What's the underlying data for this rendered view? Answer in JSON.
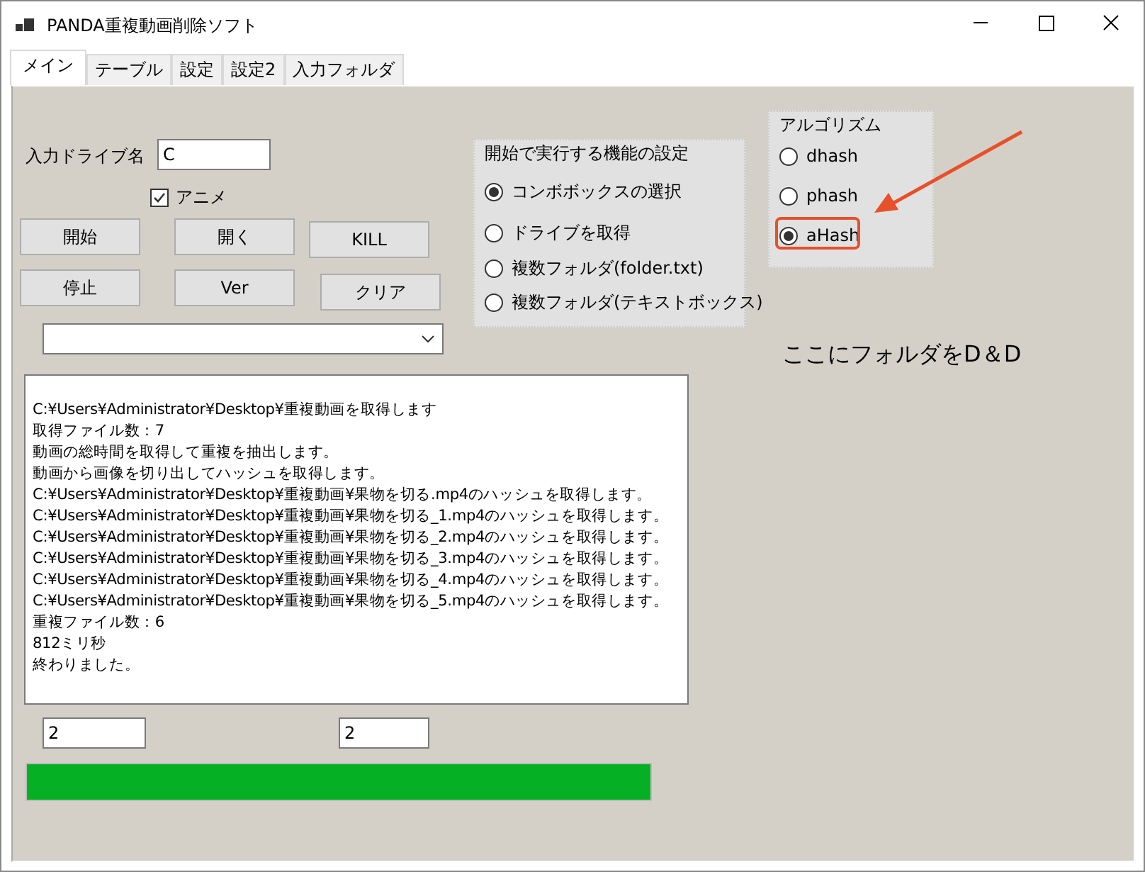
{
  "window": {
    "title": "PANDA重複動画削除ソフト"
  },
  "tabs": [
    {
      "label": "メイン",
      "selected": true
    },
    {
      "label": "テーブル",
      "selected": false
    },
    {
      "label": "設定",
      "selected": false
    },
    {
      "label": "設定2",
      "selected": false
    },
    {
      "label": "入力フォルダ",
      "selected": false
    }
  ],
  "drive": {
    "label": "入力ドライブ名",
    "value": "C"
  },
  "anime": {
    "label": "アニメ",
    "checked": true
  },
  "buttons": [
    "開始",
    "開く",
    "KILL",
    "停止",
    "Ver",
    "クリア"
  ],
  "start_group": {
    "title": "開始で実行する機能の設定",
    "options": [
      {
        "label": "コンボボックスの選択",
        "selected": true
      },
      {
        "label": "ドライブを取得",
        "selected": false
      },
      {
        "label": "複数フォルダ(folder.txt)",
        "selected": false
      },
      {
        "label": "複数フォルダ(テキストボックス)",
        "selected": false
      }
    ]
  },
  "algorithm_group": {
    "title": "アルゴリズム",
    "options": [
      {
        "label": "dhash",
        "selected": false
      },
      {
        "label": "phash",
        "selected": false
      },
      {
        "label": "aHash",
        "selected": true
      }
    ]
  },
  "drop_hint": "ここにフォルダをD＆D",
  "log": [
    "C:¥Users¥Administrator¥Desktop¥重複動画を取得します",
    "取得ファイル数：7",
    "動画の総時間を取得して重複を抽出します。",
    "動画から画像を切り出してハッシュを取得します。",
    "C:¥Users¥Administrator¥Desktop¥重複動画¥果物を切る.mp4のハッシュを取得します。",
    "C:¥Users¥Administrator¥Desktop¥重複動画¥果物を切る_1.mp4のハッシュを取得します。",
    "C:¥Users¥Administrator¥Desktop¥重複動画¥果物を切る_2.mp4のハッシュを取得します。",
    "C:¥Users¥Administrator¥Desktop¥重複動画¥果物を切る_3.mp4のハッシュを取得します。",
    "C:¥Users¥Administrator¥Desktop¥重複動画¥果物を切る_4.mp4のハッシュを取得します。",
    "C:¥Users¥Administrator¥Desktop¥重複動画¥果物を切る_5.mp4のハッシュを取得します。",
    "重複ファイル数：6",
    "812ミリ秒",
    "終わりました。"
  ],
  "field_1": {
    "value": "2"
  },
  "field_2": {
    "value": "2"
  },
  "progress": {
    "level": 1.0
  }
}
